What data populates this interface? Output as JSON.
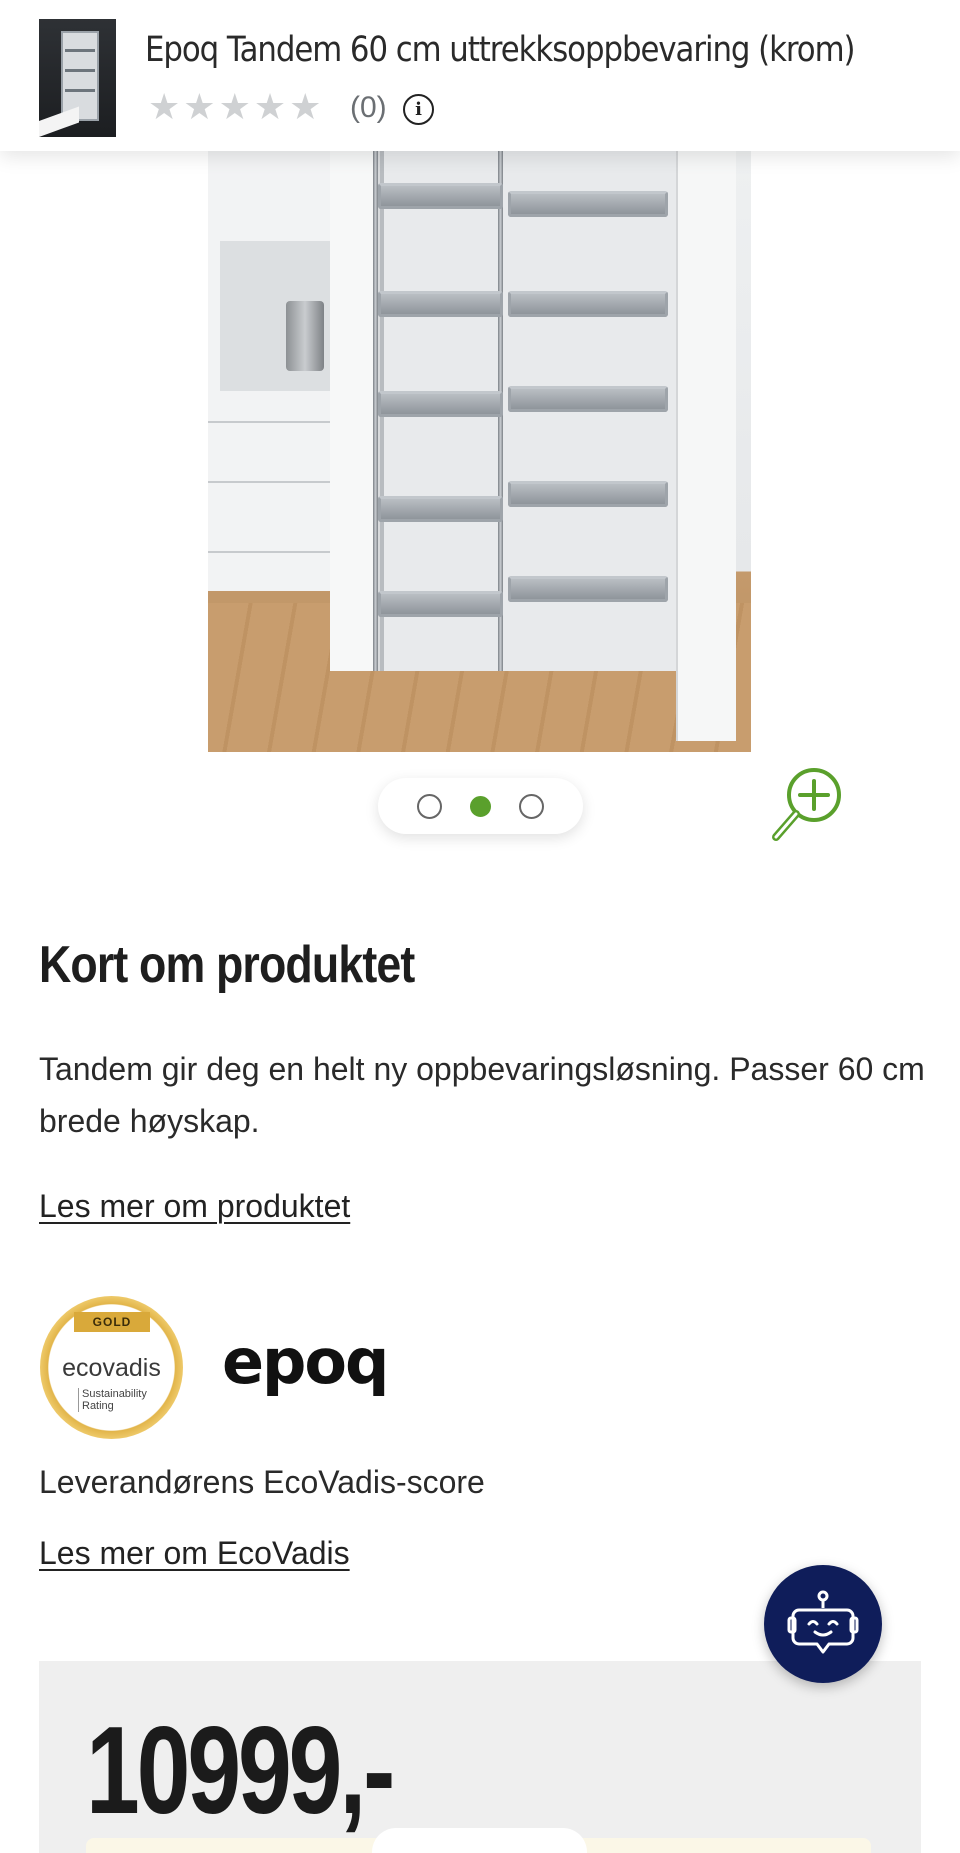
{
  "header": {
    "title": "Epoq Tandem 60 cm uttrekksoppbevaring (krom)",
    "rating_stars": 0,
    "review_count": "(0)",
    "info_icon": "info-circle-icon"
  },
  "gallery": {
    "image_alt": "Epoq Tandem uttrekksoppbevaring",
    "dots_total": 3,
    "active_dot": 2,
    "zoom_icon": "zoom-in-icon"
  },
  "content": {
    "section_title": "Kort om produktet",
    "description": "Tandem gir deg en helt ny oppbevaringsløsning. Passer 60 cm brede høyskap.",
    "read_more_product": "Les mer om produktet",
    "ecovadis_badge": {
      "ribbon": "GOLD",
      "brand": "ecovadis",
      "sub_line1": "Sustainability",
      "sub_line2": "Rating"
    },
    "supplier_logo": "epoq",
    "ecovadis_caption": "Leverandørens EcoVadis-score",
    "read_more_ecovadis": "Les mer om EcoVadis"
  },
  "chat": {
    "icon": "chatbot-robot-icon"
  },
  "price": {
    "amount": "10999,-"
  },
  "colors": {
    "accent_green": "#5aa02c",
    "chat_navy": "#0f1d5a",
    "price_box_bg": "#efefef"
  }
}
